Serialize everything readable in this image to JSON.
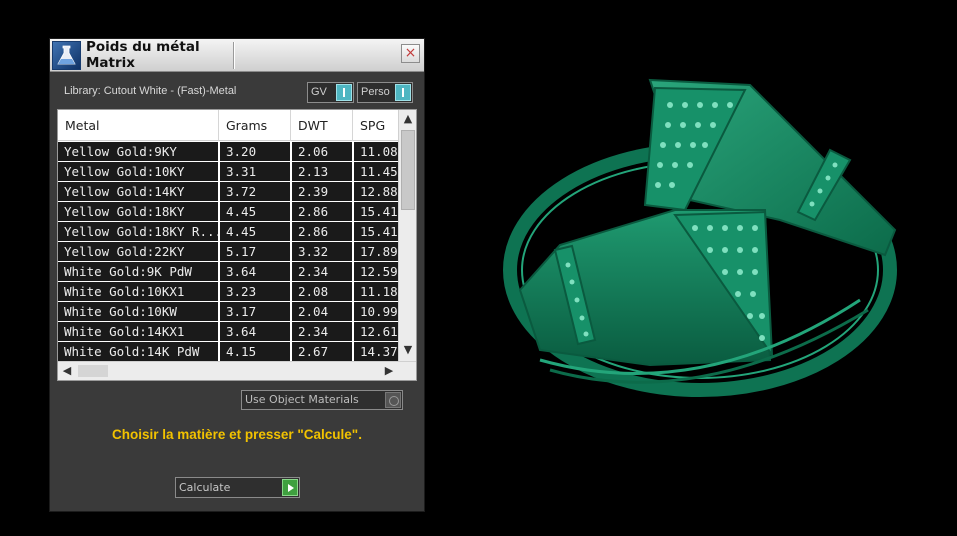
{
  "window": {
    "title": "Poids du métal\nMatrix",
    "close_label": "×"
  },
  "library_label": "Library: Cutout White - (Fast)-Metal",
  "toggles": {
    "gv": "GV",
    "perso": "Perso"
  },
  "table": {
    "columns": [
      "Metal",
      "Grams",
      "DWT",
      "SPG"
    ],
    "rows": [
      [
        "Yellow Gold:9KY",
        "3.20",
        "2.06",
        "11.08"
      ],
      [
        "Yellow Gold:10KY",
        "3.31",
        "2.13",
        "11.45"
      ],
      [
        "Yellow Gold:14KY",
        "3.72",
        "2.39",
        "12.88"
      ],
      [
        "Yellow Gold:18KY",
        "4.45",
        "2.86",
        "15.41"
      ],
      [
        "Yellow Gold:18KY R...",
        "4.45",
        "2.86",
        "15.41"
      ],
      [
        "Yellow Gold:22KY",
        "5.17",
        "3.32",
        "17.89"
      ],
      [
        "White Gold:9K PdW",
        "3.64",
        "2.34",
        "12.59"
      ],
      [
        "White Gold:10KX1",
        "3.23",
        "2.08",
        "11.18"
      ],
      [
        "White Gold:10KW",
        "3.17",
        "2.04",
        "10.99"
      ],
      [
        "White Gold:14KX1",
        "3.64",
        "2.34",
        "12.61"
      ],
      [
        "White Gold:14K PdW",
        "4.15",
        "2.67",
        "14.37"
      ]
    ]
  },
  "use_object_materials_label": "Use Object Materials",
  "instruction": "Choisir la matière et presser \"Calcule\".",
  "calculate_label": "Calculate",
  "colors": {
    "accent_cyan": "#4fb6c2",
    "instruction_yellow": "#f2c200",
    "ring_green": "#1e8f6a",
    "calculate_green": "#3fa03f"
  }
}
